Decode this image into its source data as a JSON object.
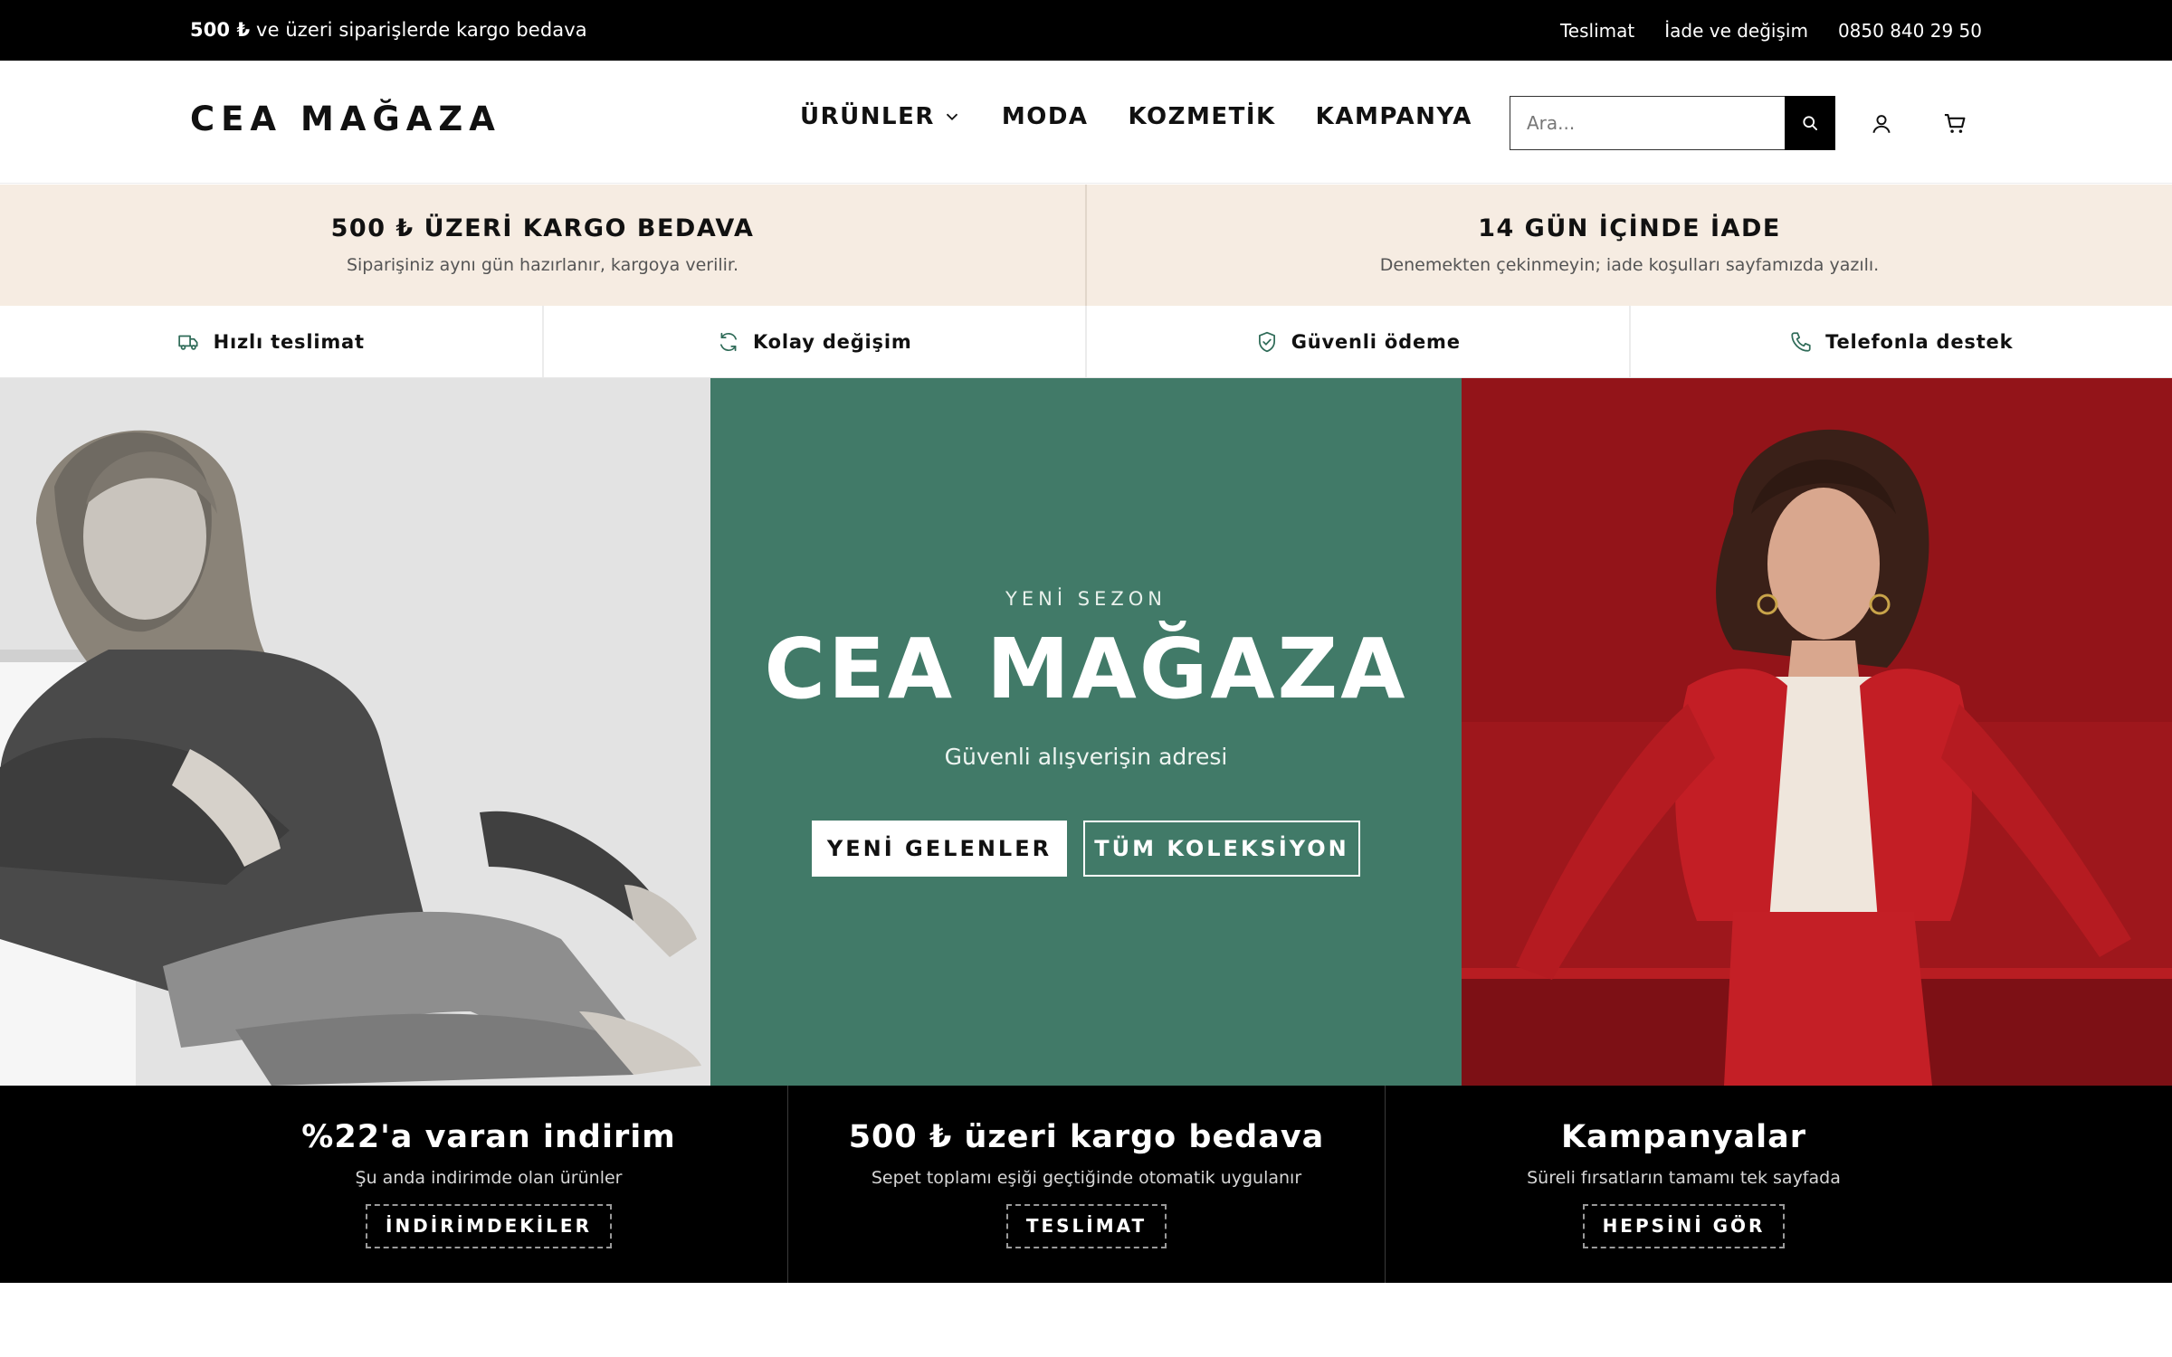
{
  "topbar": {
    "promo_bold": "500 ₺",
    "promo_text": " ve üzeri siparişlerde kargo bedava",
    "links": [
      "Teslimat",
      "İade ve değişim",
      "0850 840 29 50"
    ]
  },
  "header": {
    "logo": "CEA MAĞAZA",
    "nav": [
      "ÜRÜNLER",
      "MODA",
      "KOZMETİK",
      "KAMPANYA"
    ],
    "search_placeholder": "Ara...",
    "icons": [
      "search-icon",
      "user-icon",
      "cart-icon"
    ]
  },
  "info": [
    {
      "title": "500 ₺ ÜZERİ KARGO BEDAVA",
      "text": "Siparişiniz aynı gün hazırlanır, kargoya verilir."
    },
    {
      "title": "14 GÜN İÇİNDE İADE",
      "text": "Denemekten çekinmeyin; iade koşulları sayfamızda yazılı."
    }
  ],
  "features": [
    {
      "label": "Hızlı teslimat",
      "icon": "truck-icon"
    },
    {
      "label": "Kolay değişim",
      "icon": "refresh-icon"
    },
    {
      "label": "Güvenli ödeme",
      "icon": "shield-check-icon"
    },
    {
      "label": "Telefonla destek",
      "icon": "phone-icon"
    }
  ],
  "hero": {
    "eyebrow": "YENİ SEZON",
    "title": "CEA MAĞAZA",
    "subtitle": "Güvenli alışverişin adresi",
    "primary_button": "YENİ GELENLER",
    "secondary_button": "TÜM KOLEKSİYON"
  },
  "promos": [
    {
      "title": "%22'a varan indirim",
      "text": "Şu anda indirimde olan ürünler",
      "button": "İNDİRİMDEKİLER"
    },
    {
      "title": "500 ₺ üzeri kargo bedava",
      "text": "Sepet toplamı eşiği geçtiğinde otomatik uygulanır",
      "button": "TESLİMAT"
    },
    {
      "title": "Kampanyalar",
      "text": "Süreli fırsatların tamamı tek sayfada",
      "button": "HEPSİNİ GÖR"
    }
  ],
  "colors": {
    "topbar": "#000000",
    "info_band": "#f6ece2",
    "hero_green": "#417a68",
    "hero_red": "#a8181d",
    "feature_icon": "#2f6b58"
  }
}
